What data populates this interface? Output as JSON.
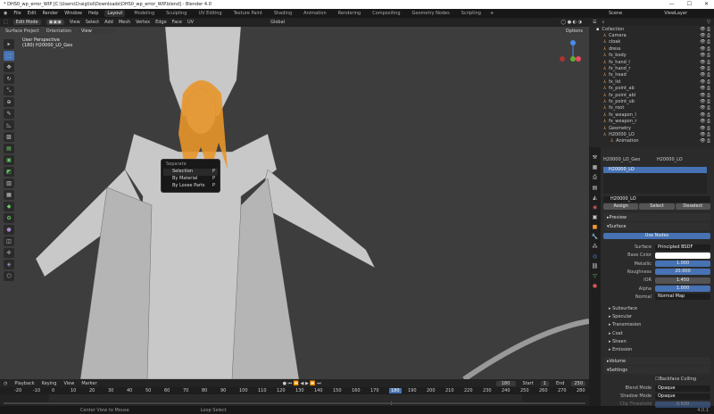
{
  "window": {
    "title": "* DHS0_wp_error_WIP [C:\\Users\\Craig\\lol\\Downloads\\DHS0_wp_error_WIP.blend] - Blender 4.0",
    "controls": [
      "—",
      "☐",
      "✕"
    ]
  },
  "menu": {
    "items": [
      "File",
      "Edit",
      "Render",
      "Window",
      "Help"
    ],
    "workspaces": [
      "Layout",
      "Modeling",
      "Sculpting",
      "UV Editing",
      "Texture Paint",
      "Shading",
      "Animation",
      "Rendering",
      "Compositing",
      "Geometry Nodes",
      "Scripting"
    ],
    "active_workspace": "Layout",
    "scene": "Scene",
    "view_layer": "ViewLayer"
  },
  "viewport": {
    "mode": "Edit Mode",
    "menus": [
      "View",
      "Select",
      "Add",
      "Mesh",
      "Vertex",
      "Edge",
      "Face",
      "UV"
    ],
    "transform": "Global",
    "surface_project": "Surface Project",
    "orientation_label": "Orientation",
    "orientation": "View",
    "options": "Options",
    "view_name": "User Perspective",
    "object_info": "(180) H20000_LO_Geo"
  },
  "context_menu": {
    "title": "Separate",
    "items": [
      "Selection",
      "By Material",
      "By Loose Parts"
    ]
  },
  "outliner": {
    "items": [
      {
        "name": "Collection",
        "d": 0
      },
      {
        "name": "Camera",
        "d": 1
      },
      {
        "name": "cloak",
        "d": 1
      },
      {
        "name": "dress",
        "d": 1
      },
      {
        "name": "fx_body",
        "d": 1
      },
      {
        "name": "fx_hand_l",
        "d": 1
      },
      {
        "name": "fx_hand_r",
        "d": 1
      },
      {
        "name": "fx_head",
        "d": 1
      },
      {
        "name": "fx_lid",
        "d": 1
      },
      {
        "name": "fx_point_ab",
        "d": 1
      },
      {
        "name": "fx_point_abl",
        "d": 1
      },
      {
        "name": "fx_point_ub",
        "d": 1
      },
      {
        "name": "fx_root",
        "d": 1
      },
      {
        "name": "fx_weapon_l",
        "d": 1
      },
      {
        "name": "fx_weapon_r",
        "d": 1
      },
      {
        "name": "Geometry",
        "d": 1
      },
      {
        "name": "H20000_LO",
        "d": 1
      },
      {
        "name": "Animation",
        "d": 2
      }
    ]
  },
  "properties": {
    "object": "H20000_LO_Geo",
    "material": "H20000_LO",
    "slot": "H20000_LO",
    "slot_field": "H20000_LO",
    "actions": [
      "Assign",
      "Select",
      "Deselect"
    ],
    "sections": {
      "preview": "Preview",
      "surface": "Surface",
      "volume": "Volume",
      "settings": "Settings"
    },
    "use_nodes": "Use Nodes",
    "fields": [
      {
        "label": "Surface",
        "value": "Principled BSDF",
        "kind": "dark"
      },
      {
        "label": "Base Color",
        "value": "",
        "kind": "white"
      },
      {
        "label": "Metallic",
        "value": "1.000",
        "kind": "blue"
      },
      {
        "label": "Roughness",
        "value": "20.000",
        "kind": "blue"
      },
      {
        "label": "IOR",
        "value": "1.450",
        "kind": "gray"
      },
      {
        "label": "Alpha",
        "value": "1.000",
        "kind": "blue"
      },
      {
        "label": "Normal",
        "value": "Normal Map",
        "kind": "dark"
      }
    ],
    "subpanels": [
      "Subsurface",
      "Specular",
      "Transmission",
      "Coat",
      "Sheen",
      "Emission"
    ],
    "backface": "Backface Culling",
    "blend_label": "Blend Mode",
    "blend": "Opaque",
    "shadow_label": "Shadow Mode",
    "shadow": "Opaque",
    "clip_label": "Clip Threshold",
    "clip": "0.500"
  },
  "timeline": {
    "menus": [
      "Playback",
      "Keying",
      "View",
      "Marker"
    ],
    "current": "180",
    "start_label": "Start",
    "start": "1",
    "end_label": "End",
    "end": "250",
    "ticks": [
      "-20",
      "-10",
      "0",
      "10",
      "20",
      "30",
      "40",
      "50",
      "60",
      "70",
      "80",
      "90",
      "100",
      "110",
      "120",
      "130",
      "140",
      "150",
      "160",
      "170",
      "180",
      "190",
      "200",
      "210",
      "220",
      "230",
      "240",
      "250",
      "260",
      "270",
      "280"
    ]
  },
  "status": {
    "hints": [
      "Center View to Mouse",
      "Loop Select"
    ],
    "version": "4.0.1"
  }
}
